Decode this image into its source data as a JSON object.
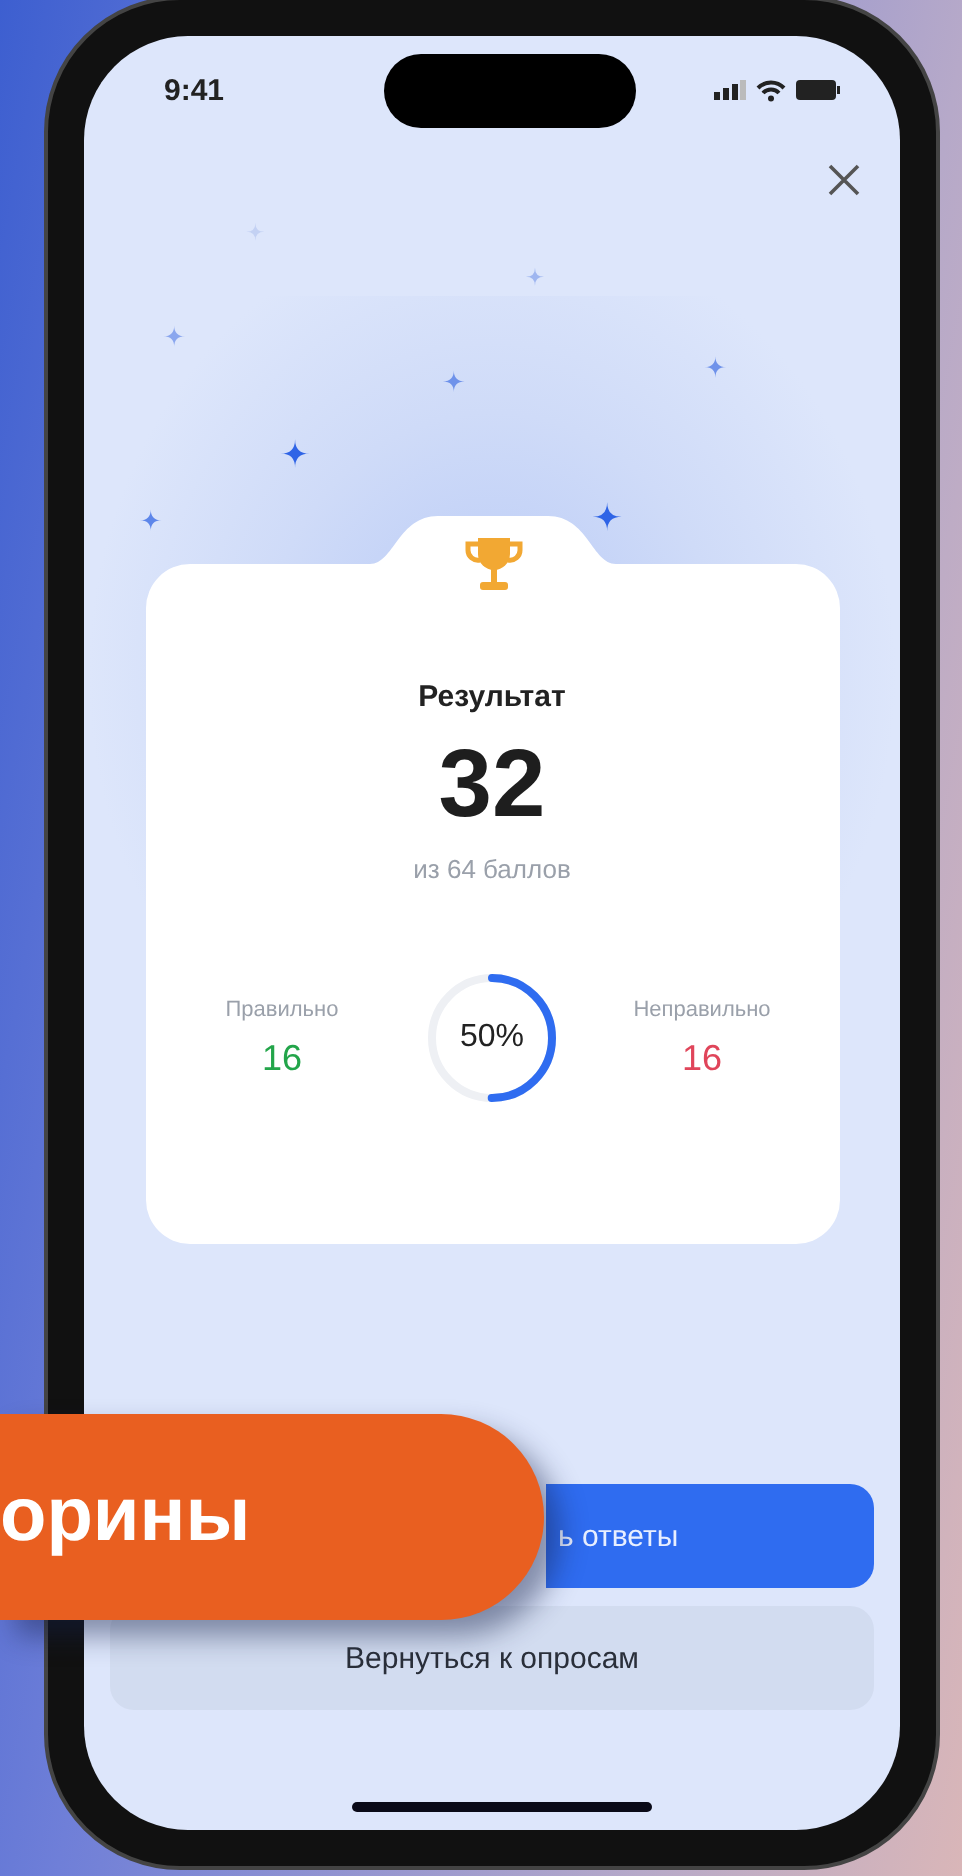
{
  "status_bar": {
    "time": "9:41"
  },
  "result": {
    "title": "Результат",
    "score": "32",
    "subtitle": "из 64 баллов",
    "correct_label": "Правильно",
    "correct_value": "16",
    "percent": "50%",
    "level": 0.5,
    "incorrect_label": "Неправильно",
    "incorrect_value": "16"
  },
  "buttons": [
    {
      "label": "ь ответы",
      "kind": "primary"
    },
    {
      "label": "Вернуться к опросам",
      "kind": "secondary"
    }
  ],
  "banner": {
    "text": "орины"
  }
}
